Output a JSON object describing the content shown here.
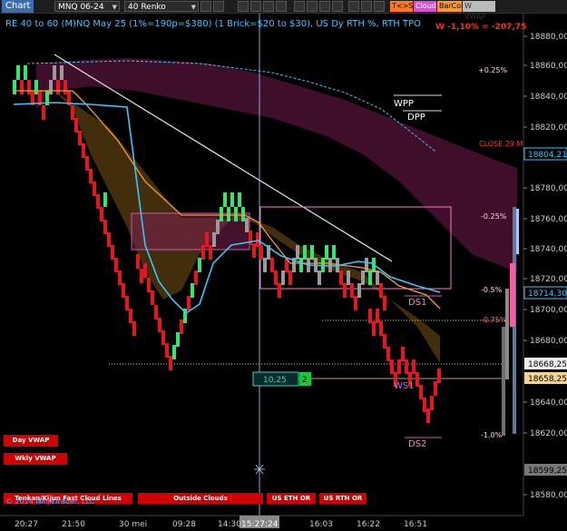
{
  "toolbar": {
    "title": "Chart",
    "instrument": "MNQ 06-24",
    "bar_type": "40 Renko",
    "buttons": [
      {
        "label": "T<>S",
        "color": "#ff7a1a"
      },
      {
        "label": "Cloud",
        "color": "#d84fd8"
      },
      {
        "label": "BarCol",
        "color": "#ff9a2a"
      },
      {
        "label": "W VWAP",
        "color": "#bbbbbb"
      }
    ]
  },
  "chart_header": "RE 40 to 60 (M)NQ May 25 (1%=190p=$380) (1 Brick=$20 to $30), US Dy RTH %, RTH TPO",
  "week_vwap_label": "W -1,10% = -207,75",
  "price_axis": {
    "ticks": [
      "18880,00",
      "18860,00",
      "18840,00",
      "18820,00",
      "18780,00",
      "18760,00",
      "18740,00",
      "18720,00",
      "18700,00",
      "18680,00",
      "18640,00",
      "18620,00",
      "18580,00"
    ],
    "markers": [
      {
        "label": "18804,21",
        "color": "#33c8ff"
      },
      {
        "label": "18714,30",
        "color": "#33c8ff"
      },
      {
        "label": "18668,25",
        "color": "#cccccc"
      },
      {
        "label": "18658,25",
        "color": "#f3d29a"
      },
      {
        "label": "18599,25",
        "color": "#888888"
      }
    ]
  },
  "time_axis": {
    "labels": [
      "20:27",
      "21:50",
      "30 mei",
      "09:28",
      "14:30",
      "15:27:24",
      "16:03",
      "16:22",
      "16:51"
    ]
  },
  "annotations": {
    "pct_up": "+0.25%",
    "wpp": "WPP",
    "dpp": "DPP",
    "close": "CLOSE 29 M",
    "pct_m025": "-0.25%",
    "pct_m05": "-0.5%",
    "pct_m075": "-0.75%",
    "pct_m1": "-1.0%",
    "ds1": "DS1",
    "ws1": "WS1",
    "ds2": "DS2",
    "box_value": "10,25",
    "box_count": "2"
  },
  "bottom_buttons": {
    "day_vwap": "Day VWAP",
    "wkly_vwap": "Wkly VWAP",
    "tenkan": "Tenkan/Kijun Fast Cloud Lines",
    "outside": "Outside Clouds",
    "us_eth": "US ETH OR",
    "us_rth": "US RTH OR"
  },
  "copyright": "© 2024 NinjaTrader, LLC",
  "colors": {
    "up_brick": "#2ee86a",
    "down_brick": "#e8141e",
    "neutral_brick": "#9a9a9a",
    "vwap_line": "#33c8ff",
    "kijun_line": "#ff9a2a",
    "cloud_fill": "#5a1640",
    "trend_line": "#e6e6e6"
  }
}
